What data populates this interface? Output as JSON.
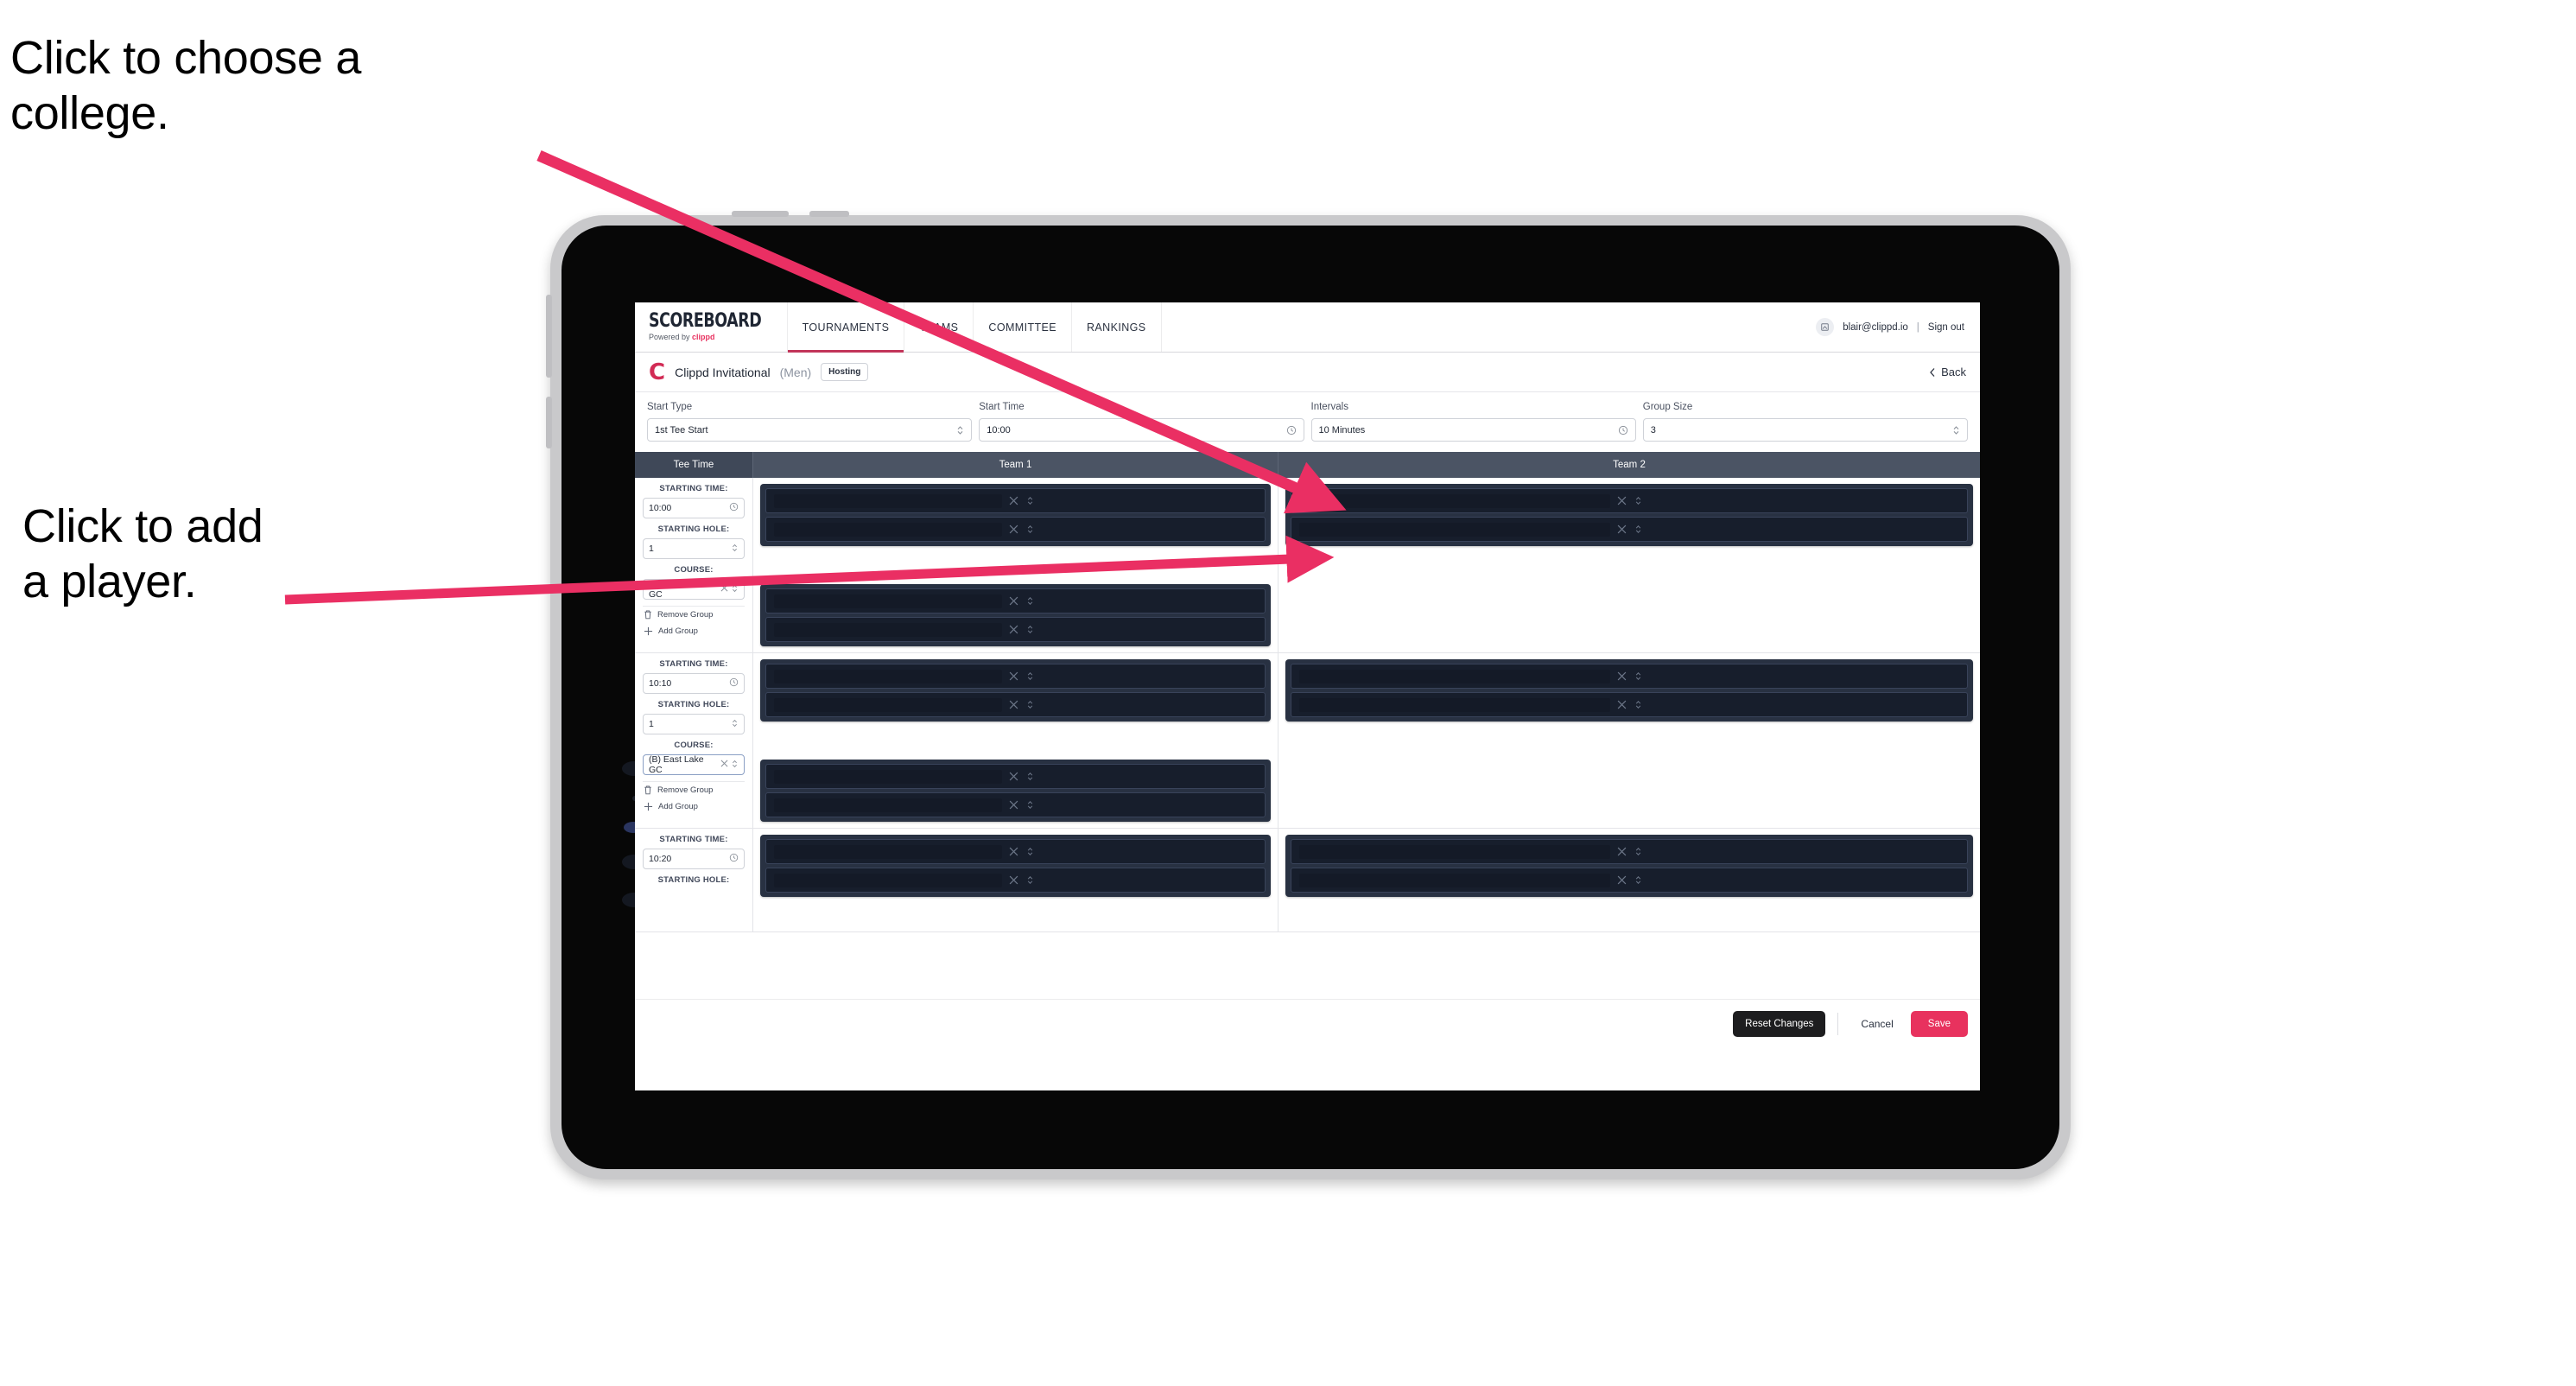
{
  "annotations": {
    "college": "Click to choose a\ncollege.",
    "player": "Click to add\na player."
  },
  "colors": {
    "accent_pink": "#e8325e",
    "brand_pink": "#d22b55",
    "table_header": "#4b5464",
    "card_dark": "#283142",
    "slot_dark": "#171e2c",
    "annotation_arrow": "#ea2f63"
  },
  "nav": {
    "brand_title": "SCOREBOARD",
    "brand_sub_prefix": "Powered by ",
    "brand_sub_brand": "clippd",
    "tabs": [
      {
        "label": "TOURNAMENTS",
        "active": true
      },
      {
        "label": "TEAMS",
        "active": false
      },
      {
        "label": "COMMITTEE",
        "active": false
      },
      {
        "label": "RANKINGS",
        "active": false
      }
    ],
    "account": {
      "avatar_icon": "user-avatar-icon",
      "email": "blair@clippd.io",
      "separator": "|",
      "sign_out": "Sign out"
    }
  },
  "tournament": {
    "logo_letter": "C",
    "name": "Clippd Invitational",
    "gender": "(Men)",
    "badge": "Hosting",
    "back_label": "Back"
  },
  "settings": [
    {
      "label": "Start Type",
      "value": "1st Tee Start",
      "icon": "stepper-icon"
    },
    {
      "label": "Start Time",
      "value": "10:00",
      "icon": "clock-icon"
    },
    {
      "label": "Intervals",
      "value": "10 Minutes",
      "icon": "clock-icon"
    },
    {
      "label": "Group Size",
      "value": "3",
      "icon": "stepper-icon"
    }
  ],
  "table": {
    "headers": {
      "tee_time": "Tee Time",
      "team1": "Team 1",
      "team2": "Team 2"
    },
    "field_labels": {
      "starting_time": "STARTING TIME:",
      "starting_hole": "STARTING HOLE:",
      "course": "COURSE:"
    },
    "actions": {
      "remove_group": "Remove Group",
      "add_group": "Add Group"
    },
    "rows": [
      {
        "starting_time": "10:00",
        "starting_hole": "1",
        "course": "(A) Peachtree GC",
        "course_focused": false,
        "team1_groups": [
          {
            "slots": 2
          },
          {
            "slots": 2
          }
        ],
        "team2_groups": [
          {
            "slots": 2
          }
        ]
      },
      {
        "starting_time": "10:10",
        "starting_hole": "1",
        "course": "(B) East Lake GC",
        "course_focused": true,
        "team1_groups": [
          {
            "slots": 2
          },
          {
            "slots": 2
          }
        ],
        "team2_groups": [
          {
            "slots": 2
          }
        ]
      },
      {
        "starting_time": "10:20",
        "starting_hole": "",
        "course": "",
        "course_focused": false,
        "team1_groups": [
          {
            "slots": 2
          }
        ],
        "team2_groups": [
          {
            "slots": 2
          }
        ]
      }
    ]
  },
  "footer": {
    "reset": "Reset Changes",
    "cancel": "Cancel",
    "save": "Save"
  }
}
